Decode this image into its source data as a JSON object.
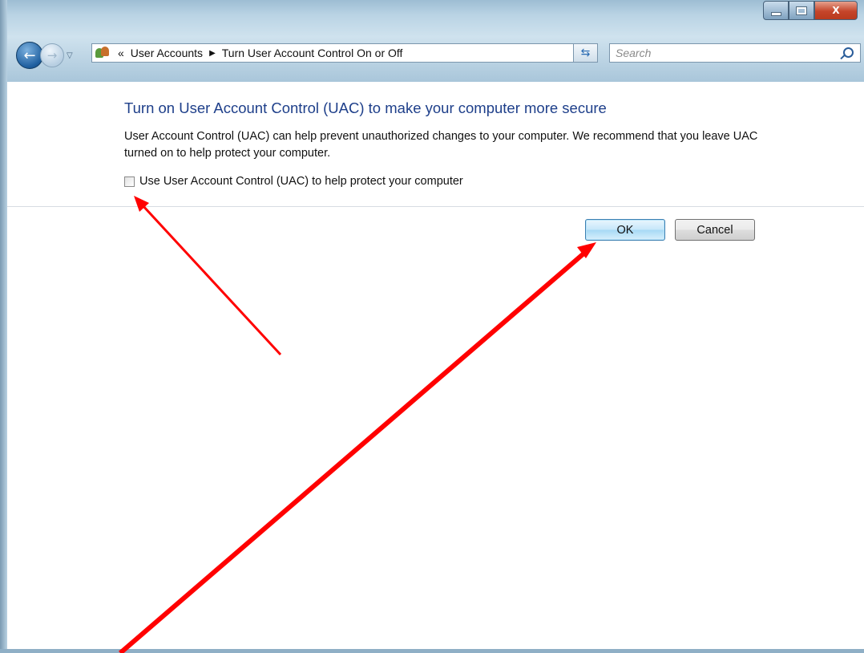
{
  "titlebar": {
    "caption_buttons": {
      "minimize_icon": "minimize-icon",
      "maximize_icon": "maximize-icon",
      "close_icon": "close-icon",
      "close_label": "X"
    }
  },
  "nav": {
    "back_icon": "back-arrow-icon",
    "forward_icon": "forward-arrow-icon",
    "recent_icon": "chevron-down-icon"
  },
  "address": {
    "icon": "user-accounts-icon",
    "chevron": "«",
    "crumbs": [
      "User Accounts",
      "Turn User Account Control On or Off"
    ],
    "separator": "▶",
    "dropdown": "▼",
    "refresh_icon": "refresh-icon",
    "refresh_glyph": "⇆"
  },
  "search": {
    "placeholder": "Search",
    "icon": "search-icon"
  },
  "main": {
    "heading": "Turn on User Account Control (UAC) to make your computer more secure",
    "description": "User Account Control (UAC) can help prevent unauthorized changes to your computer.  We recommend that you leave UAC turned on to help protect your computer.",
    "checkbox_label": "Use User Account Control (UAC) to help protect your computer",
    "checkbox_checked": false,
    "ok_label": "OK",
    "cancel_label": "Cancel"
  },
  "annotations": {
    "arrow_color": "#ff0000"
  }
}
